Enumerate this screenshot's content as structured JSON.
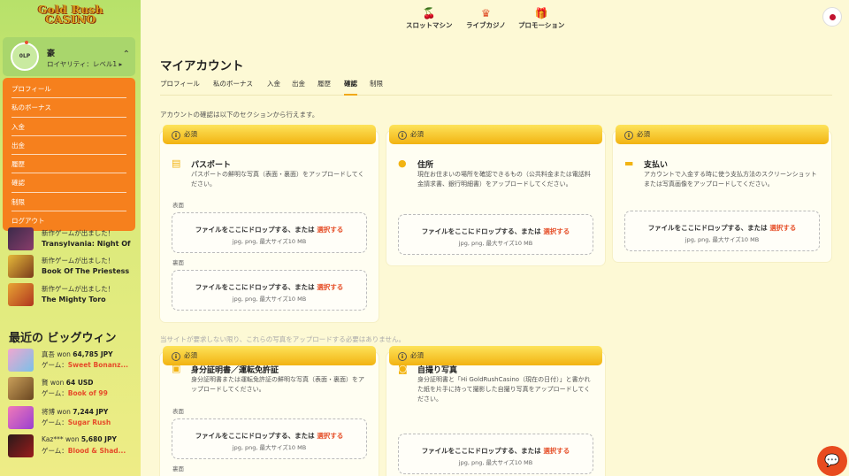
{
  "brand": {
    "logo": "GoldRush CASINO"
  },
  "user": {
    "level_badge": "0LP",
    "name": "豪",
    "loyalty": "ロイヤリティ：レベル1 ▸"
  },
  "menu": [
    "プロフィール",
    "私のボーナス",
    "入金",
    "出金",
    "履歴",
    "確認",
    "制限",
    "ログアウト"
  ],
  "news": [
    {
      "t1": "新作ゲームが出ました！",
      "t2": "Transylvania: Night Of"
    },
    {
      "t1": "新作ゲームが出ました！",
      "t2": "Book Of The Priestess"
    },
    {
      "t1": "新作ゲームが出ました！",
      "t2": "The Mighty Toro"
    }
  ],
  "bigwins": {
    "title": "最近の ビッグウィン",
    "items": [
      {
        "user": "真吾",
        "won": "won",
        "amount": "64,785 JPY",
        "game_label": "ゲーム：",
        "game": "Sweet Bonanz..."
      },
      {
        "user": "賢",
        "won": "won",
        "amount": "64 USD",
        "game_label": "ゲーム：",
        "game": "Book of 99"
      },
      {
        "user": "将博",
        "won": "won",
        "amount": "7,244 JPY",
        "game_label": "ゲーム：",
        "game": "Sugar Rush"
      },
      {
        "user": "Kaz***",
        "won": "won",
        "amount": "5,680 JPY",
        "game_label": "ゲーム：",
        "game": "Blood & Shad..."
      }
    ]
  },
  "topnav": [
    {
      "label": "スロットマシン",
      "icon": "cherry-icon"
    },
    {
      "label": "ライブカジノ",
      "icon": "dealer-icon"
    },
    {
      "label": "プロモーション",
      "icon": "gift-icon"
    }
  ],
  "page": {
    "title": "マイアカウント",
    "tabs": [
      "プロフィール",
      "私のボーナス",
      "入金",
      "出金",
      "履歴",
      "確認",
      "制限"
    ],
    "active_tab": "確認",
    "intro": "アカウントの確認は以下のセクションから行えます。",
    "note": "当サイトが要求しない限り、これらの写真をアップロードする必要はありません。"
  },
  "upload": {
    "required": "必須",
    "drop_text": "ファイルをここにドロップする、または",
    "select": "選択する",
    "formats": "jpg, png, 最大サイズ10 MB",
    "front": "表面",
    "back": "裏面"
  },
  "cards": {
    "passport": {
      "title": "パスポート",
      "desc": "パスポートの鮮明な写真（表面・裏面）をアップロードしてください。"
    },
    "address": {
      "title": "住所",
      "desc": "現在お住まいの場所を確認できるもの（公共料金または電話料金請求書、銀行明細書）をアップロードしてください。"
    },
    "payment": {
      "title": "支払い",
      "desc": "アカウントで入金する時に使う支払方法のスクリーンショットまたは写真画像をアップロードしてください。"
    },
    "id": {
      "title": "身分証明書／運転免許証",
      "desc": "身分証明書または運転免許証の鮮明な写真（表面・裏面）をアップロードしてください。"
    },
    "selfie": {
      "title": "自撮り写真",
      "desc": "身分証明書と「Hi GoldRushCasino（現在の日付）」と書かれた紙を片手に持って撮影した自撮り写真をアップロードしてください。"
    }
  },
  "colors": {
    "accent": "#f6801d",
    "gold": "#f2b312",
    "link": "#e6512b",
    "sidebar": "#b7e16a",
    "bg": "#fdf9d5"
  }
}
